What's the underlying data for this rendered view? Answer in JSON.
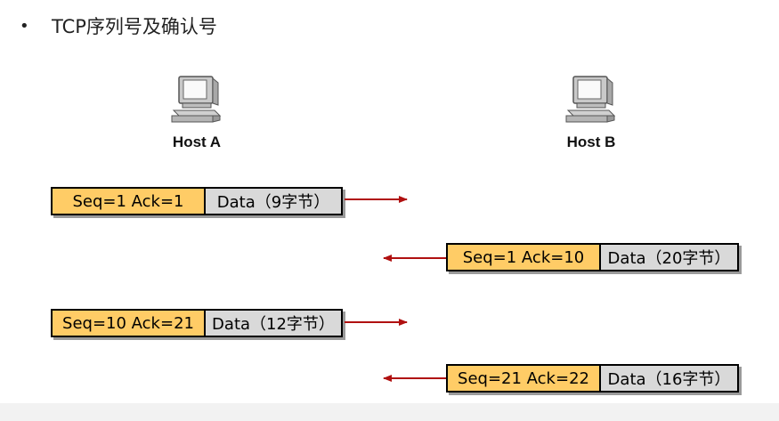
{
  "slide": {
    "bullet": "•",
    "title": "TCP序列号及确认号"
  },
  "hosts": {
    "a": {
      "label": "Host A",
      "icon": "desktop-computer-icon"
    },
    "b": {
      "label": "Host B",
      "icon": "desktop-computer-icon"
    }
  },
  "segments": [
    {
      "header": "Seq=1  Ack=1",
      "data": "Data（9字节）",
      "direction": "A-to-B"
    },
    {
      "header": "Seq=1  Ack=10",
      "data": "Data（20字节）",
      "direction": "B-to-A"
    },
    {
      "header": "Seq=10  Ack=21",
      "data": "Data（12字节）",
      "direction": "A-to-B"
    },
    {
      "header": "Seq=21  Ack=22",
      "data": "Data（16字节）",
      "direction": "B-to-A"
    }
  ],
  "colors": {
    "header_fill": "#ffcc66",
    "data_fill": "#d9d9d9",
    "arrow": "#b01010"
  }
}
